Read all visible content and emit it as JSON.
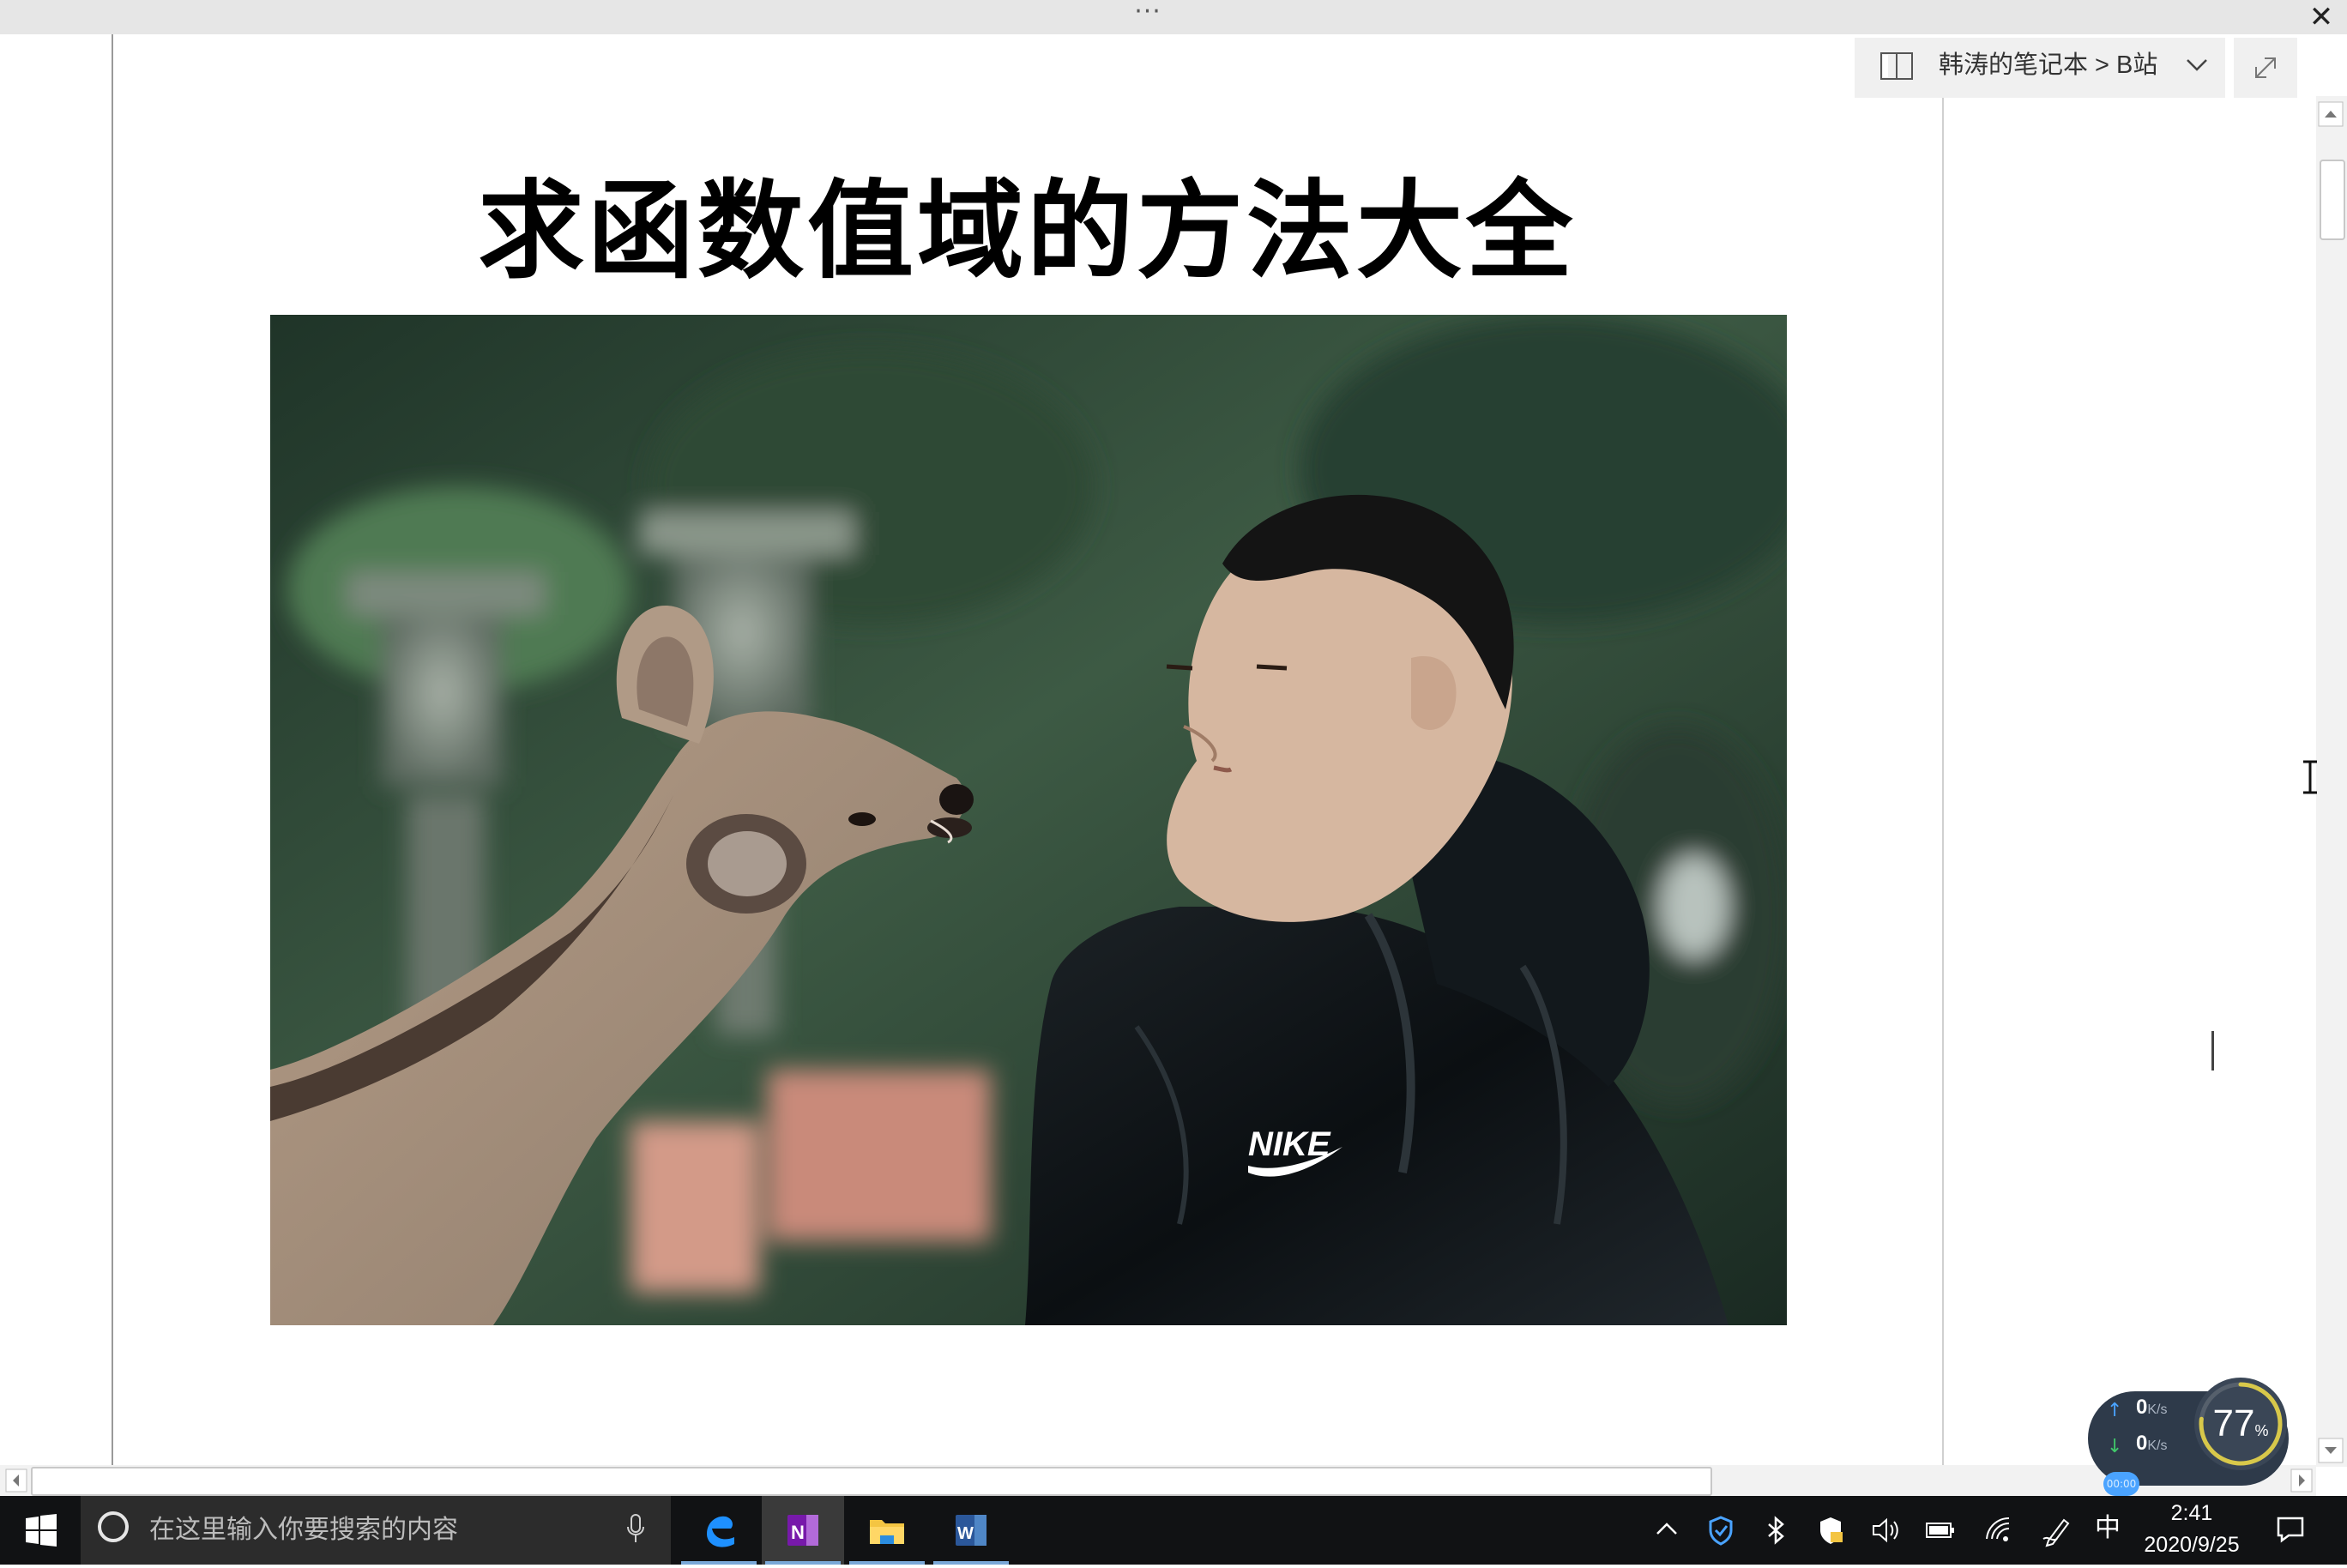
{
  "window": {
    "grip_label": "···",
    "close_label": "✕"
  },
  "notebook": {
    "breadcrumb": "韩涛的笔记本 > B站"
  },
  "page": {
    "title": "求函数值域的方法大全"
  },
  "photo": {
    "alt": "",
    "jacket_logo": "NIKE"
  },
  "network_monitor": {
    "upload": "0",
    "download": "0",
    "unit": "K/s",
    "percent": "77",
    "percent_unit": "%",
    "timer": "00:00"
  },
  "taskbar": {
    "search_placeholder": "在这里输入你要搜索的内容",
    "apps": [
      "Microsoft Edge",
      "OneNote",
      "File Explorer",
      "Word"
    ],
    "ime_label": "中",
    "clock_time": "2:41",
    "clock_date": "2020/9/25"
  },
  "colors": {
    "onenote": "#7719aa",
    "word": "#2b579a",
    "edge": "#0078d7",
    "taskbar": "#111214"
  }
}
